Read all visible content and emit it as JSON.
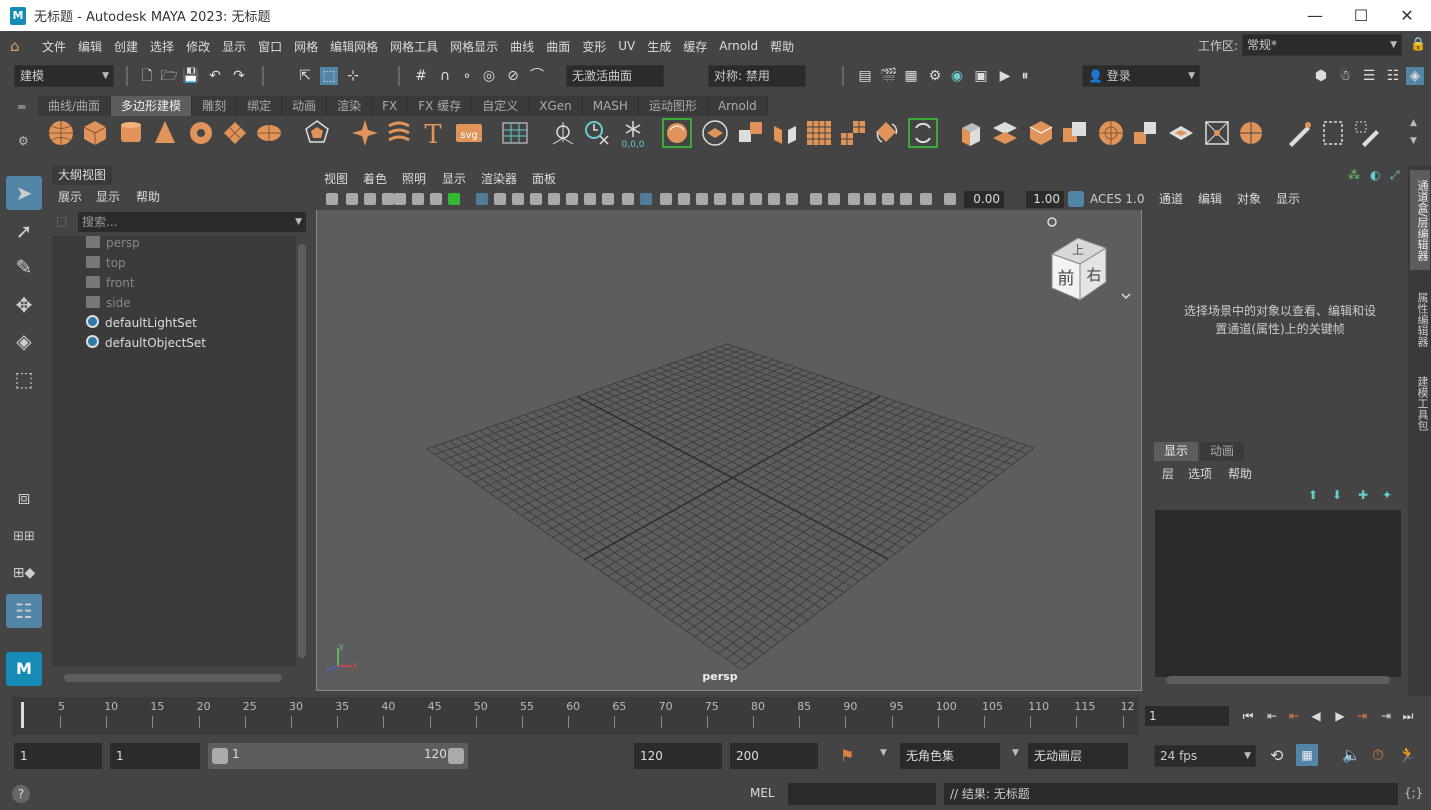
{
  "titlebar": {
    "logo": "M",
    "title": "无标题 - Autodesk MAYA 2023: 无标题",
    "minimize": "—",
    "maximize": "☐",
    "close": "✕"
  },
  "menubar": {
    "items": [
      "文件",
      "编辑",
      "创建",
      "选择",
      "修改",
      "显示",
      "窗口",
      "网格",
      "编辑网格",
      "网格工具",
      "网格显示",
      "曲线",
      "曲面",
      "变形",
      "UV",
      "生成",
      "缓存",
      "Arnold",
      "帮助"
    ],
    "workspace_label": "工作区:",
    "workspace_value": "常规*"
  },
  "statusline": {
    "menu_set": "建模",
    "live_surface": "无激活曲面",
    "symmetry": "对称: 禁用",
    "login": "登录"
  },
  "shelf": {
    "tabs": [
      "曲线/曲面",
      "多边形建模",
      "雕刻",
      "绑定",
      "动画",
      "渲染",
      "FX",
      "FX 缓存",
      "自定义",
      "XGen",
      "MASH",
      "运动图形",
      "Arnold"
    ],
    "active_tab": 1
  },
  "outliner": {
    "tab": "大纲视图",
    "menu": [
      "展示",
      "显示",
      "帮助"
    ],
    "search_placeholder": "搜索...",
    "items": [
      {
        "label": "persp",
        "type": "camera",
        "dim": true
      },
      {
        "label": "top",
        "type": "camera",
        "dim": true
      },
      {
        "label": "front",
        "type": "camera",
        "dim": true
      },
      {
        "label": "side",
        "type": "camera",
        "dim": true
      },
      {
        "label": "defaultLightSet",
        "type": "set",
        "dim": false
      },
      {
        "label": "defaultObjectSet",
        "type": "set",
        "dim": false
      }
    ]
  },
  "viewport": {
    "menu": [
      "视图",
      "着色",
      "照明",
      "显示",
      "渲染器",
      "面板"
    ],
    "exposure": "0.00",
    "gamma": "1.00",
    "color_space": "ACES 1.0",
    "camera_name": "persp",
    "viewcube": {
      "top": "上",
      "front": "前",
      "right": "右"
    },
    "axis": {
      "x": "x",
      "y": "y",
      "z": "z"
    }
  },
  "channelbox": {
    "menu": [
      "通道",
      "编辑",
      "对象",
      "显示"
    ],
    "message_line1": "选择场景中的对象以查看、编辑和设",
    "message_line2": "置通道(属性)上的关键帧"
  },
  "layereditor": {
    "tabs": [
      "显示",
      "动画"
    ],
    "menu": [
      "层",
      "选项",
      "帮助"
    ]
  },
  "right_tabs": [
    "通道盒/层编辑器",
    "属性编辑器",
    "建模工具包"
  ],
  "timeslider": {
    "ticks": [
      "5",
      "10",
      "15",
      "20",
      "25",
      "30",
      "35",
      "40",
      "45",
      "50",
      "55",
      "60",
      "65",
      "70",
      "75",
      "80",
      "85",
      "90",
      "95",
      "100",
      "105",
      "110",
      "115",
      "12"
    ],
    "current_frame": "1"
  },
  "range": {
    "start": "1",
    "playback_start": "1",
    "range_start": "1",
    "range_end": "120",
    "playback_end": "120",
    "end": "200",
    "character_set": "无角色集",
    "anim_layer": "无动画层",
    "fps": "24 fps"
  },
  "commandline": {
    "language": "MEL",
    "result": "// 结果: 无标题"
  }
}
